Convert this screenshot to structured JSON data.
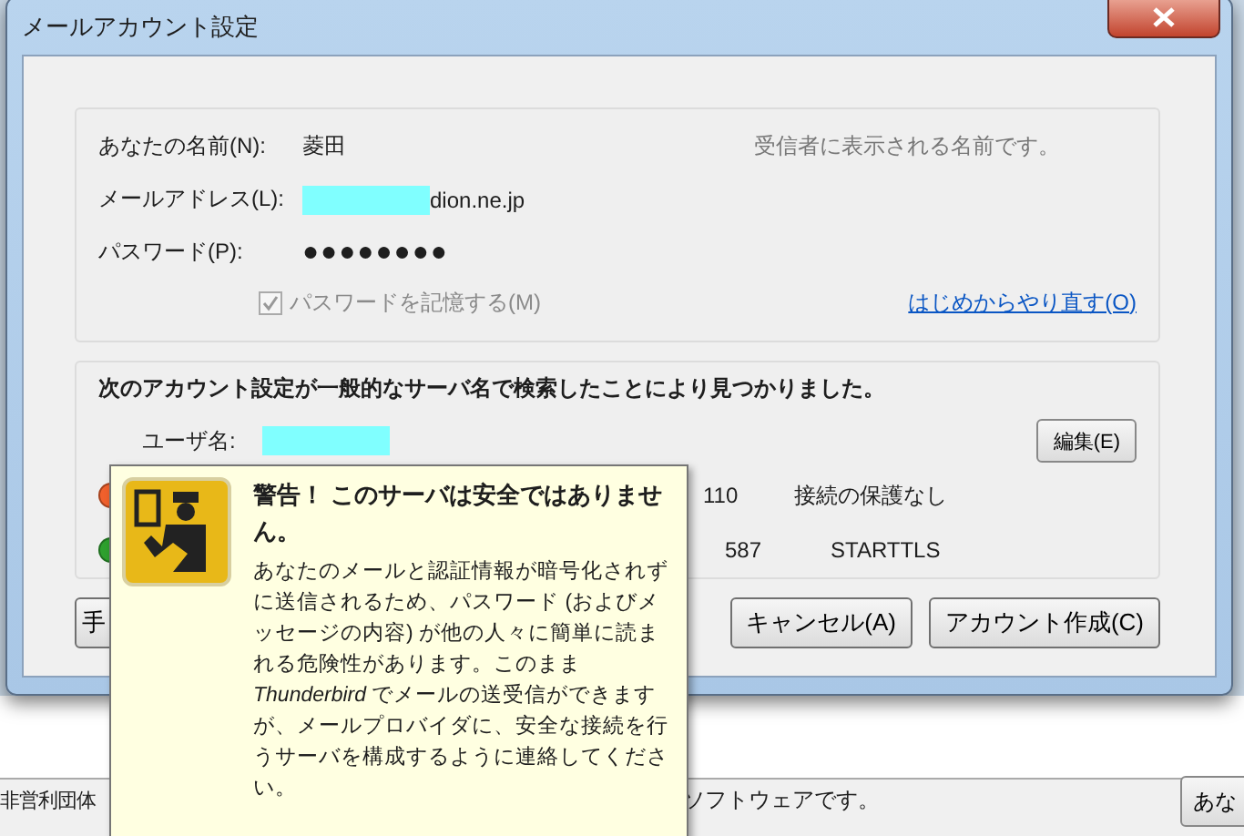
{
  "window": {
    "title": "メールアカウント設定"
  },
  "identity": {
    "name_label": "あなたの名前(N):",
    "name_value": "菱田",
    "name_hint": "受信者に表示される名前です。",
    "email_label": "メールアドレス(L):",
    "email_value": "dion.ne.jp",
    "password_label": "パスワード(P):",
    "password_value": "●●●●●●●●",
    "remember": {
      "label": "パスワードを記憶する(M)",
      "checked": true,
      "disabled": true
    },
    "restart_link": "はじめからやり直す(O)"
  },
  "found": {
    "heading": "次のアカウント設定が一般的なサーバ名で検索したことにより見つかりました。",
    "username_label": "ユーザ名:",
    "edit_button": "編集(E)",
    "servers": [
      {
        "color": "#f0602c",
        "port": "110",
        "security": "接続の保護なし"
      },
      {
        "color": "#2ea02e",
        "port": "587",
        "security": "STARTTLS"
      }
    ]
  },
  "buttons": [
    {
      "label": "手",
      "kind": "partial"
    },
    {
      "label": "キャンセル(A)",
      "kind": "normal"
    },
    {
      "label": "アカウント作成(C)",
      "kind": "normal"
    }
  ],
  "tooltip": {
    "title": "警告！ このサーバは安全ではありません。",
    "body": "あなたのメールと認証情報が暗号化されずに送信されるため、パスワード (およびメッセージの内容) が他の人々に簡単に読まれる危険性があります。このまま *Thunderbird* でメールの送受信ができますが、メールプロバイダに、安全な接続を行うサーバを構成するように連絡してください。"
  },
  "background": {
    "left_text": "非営利団体",
    "right_text": "ソフトウェアです。",
    "button": "あな"
  }
}
